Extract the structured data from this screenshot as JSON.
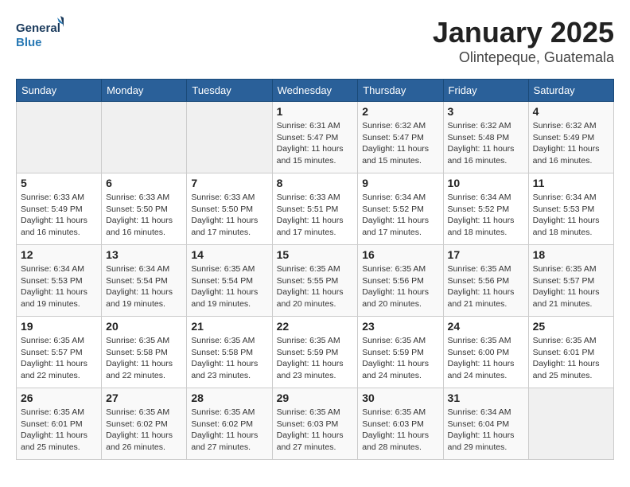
{
  "logo": {
    "line1": "General",
    "line2": "Blue"
  },
  "title": "January 2025",
  "location": "Olintepeque, Guatemala",
  "days_of_week": [
    "Sunday",
    "Monday",
    "Tuesday",
    "Wednesday",
    "Thursday",
    "Friday",
    "Saturday"
  ],
  "weeks": [
    [
      {
        "day": "",
        "info": ""
      },
      {
        "day": "",
        "info": ""
      },
      {
        "day": "",
        "info": ""
      },
      {
        "day": "1",
        "info": "Sunrise: 6:31 AM\nSunset: 5:47 PM\nDaylight: 11 hours\nand 15 minutes."
      },
      {
        "day": "2",
        "info": "Sunrise: 6:32 AM\nSunset: 5:47 PM\nDaylight: 11 hours\nand 15 minutes."
      },
      {
        "day": "3",
        "info": "Sunrise: 6:32 AM\nSunset: 5:48 PM\nDaylight: 11 hours\nand 16 minutes."
      },
      {
        "day": "4",
        "info": "Sunrise: 6:32 AM\nSunset: 5:49 PM\nDaylight: 11 hours\nand 16 minutes."
      }
    ],
    [
      {
        "day": "5",
        "info": "Sunrise: 6:33 AM\nSunset: 5:49 PM\nDaylight: 11 hours\nand 16 minutes."
      },
      {
        "day": "6",
        "info": "Sunrise: 6:33 AM\nSunset: 5:50 PM\nDaylight: 11 hours\nand 16 minutes."
      },
      {
        "day": "7",
        "info": "Sunrise: 6:33 AM\nSunset: 5:50 PM\nDaylight: 11 hours\nand 17 minutes."
      },
      {
        "day": "8",
        "info": "Sunrise: 6:33 AM\nSunset: 5:51 PM\nDaylight: 11 hours\nand 17 minutes."
      },
      {
        "day": "9",
        "info": "Sunrise: 6:34 AM\nSunset: 5:52 PM\nDaylight: 11 hours\nand 17 minutes."
      },
      {
        "day": "10",
        "info": "Sunrise: 6:34 AM\nSunset: 5:52 PM\nDaylight: 11 hours\nand 18 minutes."
      },
      {
        "day": "11",
        "info": "Sunrise: 6:34 AM\nSunset: 5:53 PM\nDaylight: 11 hours\nand 18 minutes."
      }
    ],
    [
      {
        "day": "12",
        "info": "Sunrise: 6:34 AM\nSunset: 5:53 PM\nDaylight: 11 hours\nand 19 minutes."
      },
      {
        "day": "13",
        "info": "Sunrise: 6:34 AM\nSunset: 5:54 PM\nDaylight: 11 hours\nand 19 minutes."
      },
      {
        "day": "14",
        "info": "Sunrise: 6:35 AM\nSunset: 5:54 PM\nDaylight: 11 hours\nand 19 minutes."
      },
      {
        "day": "15",
        "info": "Sunrise: 6:35 AM\nSunset: 5:55 PM\nDaylight: 11 hours\nand 20 minutes."
      },
      {
        "day": "16",
        "info": "Sunrise: 6:35 AM\nSunset: 5:56 PM\nDaylight: 11 hours\nand 20 minutes."
      },
      {
        "day": "17",
        "info": "Sunrise: 6:35 AM\nSunset: 5:56 PM\nDaylight: 11 hours\nand 21 minutes."
      },
      {
        "day": "18",
        "info": "Sunrise: 6:35 AM\nSunset: 5:57 PM\nDaylight: 11 hours\nand 21 minutes."
      }
    ],
    [
      {
        "day": "19",
        "info": "Sunrise: 6:35 AM\nSunset: 5:57 PM\nDaylight: 11 hours\nand 22 minutes."
      },
      {
        "day": "20",
        "info": "Sunrise: 6:35 AM\nSunset: 5:58 PM\nDaylight: 11 hours\nand 22 minutes."
      },
      {
        "day": "21",
        "info": "Sunrise: 6:35 AM\nSunset: 5:58 PM\nDaylight: 11 hours\nand 23 minutes."
      },
      {
        "day": "22",
        "info": "Sunrise: 6:35 AM\nSunset: 5:59 PM\nDaylight: 11 hours\nand 23 minutes."
      },
      {
        "day": "23",
        "info": "Sunrise: 6:35 AM\nSunset: 5:59 PM\nDaylight: 11 hours\nand 24 minutes."
      },
      {
        "day": "24",
        "info": "Sunrise: 6:35 AM\nSunset: 6:00 PM\nDaylight: 11 hours\nand 24 minutes."
      },
      {
        "day": "25",
        "info": "Sunrise: 6:35 AM\nSunset: 6:01 PM\nDaylight: 11 hours\nand 25 minutes."
      }
    ],
    [
      {
        "day": "26",
        "info": "Sunrise: 6:35 AM\nSunset: 6:01 PM\nDaylight: 11 hours\nand 25 minutes."
      },
      {
        "day": "27",
        "info": "Sunrise: 6:35 AM\nSunset: 6:02 PM\nDaylight: 11 hours\nand 26 minutes."
      },
      {
        "day": "28",
        "info": "Sunrise: 6:35 AM\nSunset: 6:02 PM\nDaylight: 11 hours\nand 27 minutes."
      },
      {
        "day": "29",
        "info": "Sunrise: 6:35 AM\nSunset: 6:03 PM\nDaylight: 11 hours\nand 27 minutes."
      },
      {
        "day": "30",
        "info": "Sunrise: 6:35 AM\nSunset: 6:03 PM\nDaylight: 11 hours\nand 28 minutes."
      },
      {
        "day": "31",
        "info": "Sunrise: 6:34 AM\nSunset: 6:04 PM\nDaylight: 11 hours\nand 29 minutes."
      },
      {
        "day": "",
        "info": ""
      }
    ]
  ]
}
